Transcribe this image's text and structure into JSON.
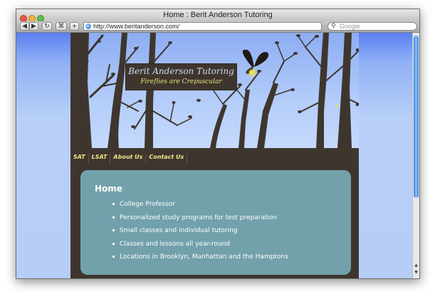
{
  "window": {
    "title": "Home : Berit Anderson Tutoring"
  },
  "toolbar": {
    "back_icon": "back-arrow-icon",
    "forward_icon": "forward-arrow-icon",
    "reload_icon": "reload-icon",
    "url": "http://www.beritanderson.com/",
    "search_placeholder": "Google"
  },
  "site": {
    "logo_title": "Berit Anderson Tutoring",
    "logo_tagline": "Fireflies are Crepuscular",
    "nav": [
      "SAT",
      "LSAT",
      "About Us",
      "Contact Us"
    ],
    "heading": "Home",
    "items": [
      "College Professor",
      "Personalized study programs for test preparation",
      "Small classes and individual tutoring",
      "Classes and lessons all year-round",
      "Locations in Brooklyn, Manhattan and the Hamptons"
    ]
  },
  "colors": {
    "header_sky": "#9db9f4",
    "site_brown": "#3e362e",
    "panel": "#72a1ab",
    "nav_text": "#f1e38a",
    "firefly_glow": "#e8e24a"
  }
}
